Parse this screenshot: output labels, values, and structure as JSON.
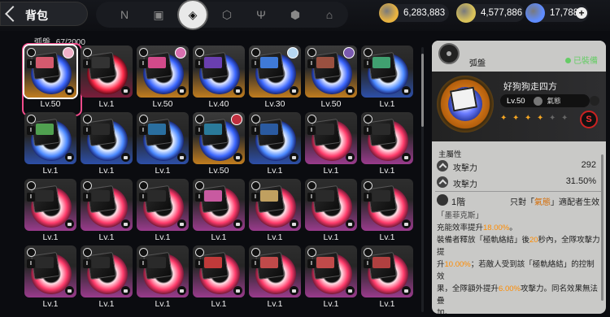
{
  "header": {
    "title": "背包"
  },
  "categories": [
    {
      "icon": "n-logo-icon",
      "glyph": "N",
      "active": false
    },
    {
      "icon": "device-icon",
      "glyph": "▣",
      "active": false
    },
    {
      "icon": "drive-disc-icon",
      "glyph": "◈",
      "active": true
    },
    {
      "icon": "cube-icon",
      "glyph": "⬡",
      "active": false
    },
    {
      "icon": "fork-knife-icon",
      "glyph": "Ψ",
      "active": false
    },
    {
      "icon": "package-icon",
      "glyph": "⬢",
      "active": false
    },
    {
      "icon": "home-icon",
      "glyph": "⌂",
      "active": false
    }
  ],
  "currencies": [
    {
      "icon": "coin-icon",
      "value": "6,283,883",
      "color": "#e8b341"
    },
    {
      "icon": "ticket-icon",
      "value": "4,577,886",
      "color": "#d9c25a"
    },
    {
      "icon": "polychrome-icon",
      "value": "17,788",
      "color": "#5f8cff"
    }
  ],
  "inventory": {
    "label": "弧盤",
    "count": "67/2000",
    "items": [
      {
        "lv": "Lv.50",
        "bg": "orange",
        "art": "#d45a6e",
        "agent": "#f0b0c8",
        "selected": true
      },
      {
        "lv": "Lv.1",
        "bg": "dark",
        "art": "#333",
        "agent": "",
        "selected": false
      },
      {
        "lv": "Lv.50",
        "bg": "orange",
        "art": "#d24a8a",
        "agent": "#d870b0",
        "selected": false
      },
      {
        "lv": "Lv.40",
        "bg": "orange",
        "art": "#6a3fb0",
        "agent": "",
        "selected": false
      },
      {
        "lv": "Lv.30",
        "bg": "orange",
        "art": "#3f7ad8",
        "agent": "#b7d7f0",
        "selected": false
      },
      {
        "lv": "Lv.50",
        "bg": "orange",
        "art": "#9a5040",
        "agent": "#7a5ab0",
        "selected": false
      },
      {
        "lv": "Lv.1",
        "bg": "blue",
        "art": "#40a070",
        "agent": "",
        "selected": false
      },
      {
        "lv": "Lv.1",
        "bg": "blue",
        "art": "#50a050",
        "agent": "",
        "selected": false
      },
      {
        "lv": "Lv.1",
        "bg": "blue",
        "art": "#2a2a2a",
        "agent": "",
        "selected": false
      },
      {
        "lv": "Lv.1",
        "bg": "blue",
        "art": "#2a6fa0",
        "agent": "",
        "selected": false
      },
      {
        "lv": "Lv.50",
        "bg": "orange",
        "art": "#2a7a9a",
        "agent": "#c03040",
        "selected": false
      },
      {
        "lv": "Lv.1",
        "bg": "blue",
        "art": "#2a5aa0",
        "agent": "",
        "selected": false
      },
      {
        "lv": "Lv.1",
        "bg": "purple",
        "art": "#2a2a2a",
        "agent": "",
        "selected": false
      },
      {
        "lv": "Lv.1",
        "bg": "purple",
        "art": "#2a2a2a",
        "agent": "",
        "selected": false
      },
      {
        "lv": "Lv.1",
        "bg": "purple",
        "art": "#2a2a2a",
        "agent": "",
        "selected": false
      },
      {
        "lv": "Lv.1",
        "bg": "purple",
        "art": "#2a2a2a",
        "agent": "",
        "selected": false
      },
      {
        "lv": "Lv.1",
        "bg": "purple",
        "art": "#2a2a2a",
        "agent": "",
        "selected": false
      },
      {
        "lv": "Lv.1",
        "bg": "purple",
        "art": "#c85aa0",
        "agent": "",
        "selected": false
      },
      {
        "lv": "Lv.1",
        "bg": "purple",
        "art": "#c0a060",
        "agent": "",
        "selected": false
      },
      {
        "lv": "Lv.1",
        "bg": "purple",
        "art": "#2a2a2a",
        "agent": "",
        "selected": false
      },
      {
        "lv": "Lv.1",
        "bg": "purple",
        "art": "#2a2a2a",
        "agent": "",
        "selected": false
      },
      {
        "lv": "Lv.1",
        "bg": "purple",
        "art": "#2a2a2a",
        "agent": "",
        "selected": false
      },
      {
        "lv": "Lv.1",
        "bg": "purple",
        "art": "#2a2a2a",
        "agent": "",
        "selected": false
      },
      {
        "lv": "Lv.1",
        "bg": "purple",
        "art": "#2a2a2a",
        "agent": "",
        "selected": false
      },
      {
        "lv": "Lv.1",
        "bg": "purple",
        "art": "#c03a3a",
        "agent": "",
        "selected": false
      },
      {
        "lv": "Lv.1",
        "bg": "purple",
        "art": "#c04a4a",
        "agent": "",
        "selected": false
      },
      {
        "lv": "Lv.1",
        "bg": "purple",
        "art": "#c04a4a",
        "agent": "",
        "selected": false
      },
      {
        "lv": "Lv.1",
        "bg": "purple",
        "art": "#b04040",
        "agent": "",
        "selected": false
      }
    ]
  },
  "detail": {
    "type_label": "弧盤",
    "equipped": "已裝備",
    "name": "好狗狗走四方",
    "level": "Lv.50",
    "agent": "氣態",
    "stars": 4,
    "stars_total": 6,
    "tier_badge": "S",
    "main_attr_title": "主屬性",
    "stats": [
      {
        "name": "攻擊力",
        "value": "292"
      },
      {
        "name": "攻擊力",
        "value": "31.50%"
      }
    ],
    "tier": "1階",
    "tier_note_prefix": "只對「",
    "tier_note_agent": "氣態",
    "tier_note_suffix": "」適配者生效",
    "desc_name": "「墨菲克斯」",
    "desc_l1a": "充能效率提升",
    "desc_l1b": "18.00%",
    "desc_l1c": "。",
    "desc_l2a": "裝備者釋放「極軌絡結」後",
    "desc_l2b": "20",
    "desc_l2c": "秒內，全隊攻擊力提",
    "desc_l3a": "升",
    "desc_l3b": "10.00%",
    "desc_l3c": "；若敵人受到該「極軌絡結」的控制效",
    "desc_l4a": "果，全隊額外提升",
    "desc_l4b": "6.00%",
    "desc_l4c": "攻擊力。同名效果無法疊",
    "desc_l5": "加。"
  }
}
